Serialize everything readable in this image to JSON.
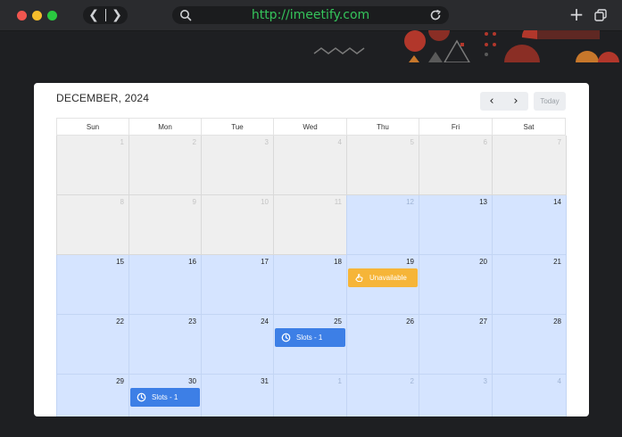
{
  "browser": {
    "url": "http://imeetify.com",
    "colors": {
      "url": "#35c35b",
      "chrome": "#2a2b2e"
    }
  },
  "calendar": {
    "title": "DECEMBER, 2024",
    "prev_label": "‹",
    "next_label": "›",
    "today_label": "Today",
    "weekdays": [
      "Sun",
      "Mon",
      "Tue",
      "Wed",
      "Thu",
      "Fri",
      "Sat"
    ],
    "weeks": [
      [
        {
          "day": "1",
          "state": "past"
        },
        {
          "day": "2",
          "state": "past"
        },
        {
          "day": "3",
          "state": "past"
        },
        {
          "day": "4",
          "state": "past"
        },
        {
          "day": "5",
          "state": "past"
        },
        {
          "day": "6",
          "state": "past"
        },
        {
          "day": "7",
          "state": "past"
        }
      ],
      [
        {
          "day": "8",
          "state": "past"
        },
        {
          "day": "9",
          "state": "past"
        },
        {
          "day": "10",
          "state": "past"
        },
        {
          "day": "11",
          "state": "past"
        },
        {
          "day": "12",
          "state": "avail-dim"
        },
        {
          "day": "13",
          "state": "avail"
        },
        {
          "day": "14",
          "state": "avail"
        }
      ],
      [
        {
          "day": "15",
          "state": "avail"
        },
        {
          "day": "16",
          "state": "avail"
        },
        {
          "day": "17",
          "state": "avail"
        },
        {
          "day": "18",
          "state": "avail"
        },
        {
          "day": "19",
          "state": "avail"
        },
        {
          "day": "20",
          "state": "avail"
        },
        {
          "day": "21",
          "state": "avail"
        }
      ],
      [
        {
          "day": "22",
          "state": "avail"
        },
        {
          "day": "23",
          "state": "avail"
        },
        {
          "day": "24",
          "state": "avail"
        },
        {
          "day": "25",
          "state": "avail"
        },
        {
          "day": "26",
          "state": "avail"
        },
        {
          "day": "27",
          "state": "avail"
        },
        {
          "day": "28",
          "state": "avail"
        }
      ],
      [
        {
          "day": "29",
          "state": "avail"
        },
        {
          "day": "30",
          "state": "avail"
        },
        {
          "day": "31",
          "state": "avail"
        },
        {
          "day": "1",
          "state": "next"
        },
        {
          "day": "2",
          "state": "next"
        },
        {
          "day": "3",
          "state": "next"
        },
        {
          "day": "4",
          "state": "next"
        }
      ]
    ],
    "events": [
      {
        "label": "Unavailable",
        "type": "unavailable",
        "icon": "hand-icon"
      },
      {
        "label": "Slots - 1",
        "type": "slot",
        "icon": "clock-icon"
      },
      {
        "label": "Slots - 1",
        "type": "slot",
        "icon": "clock-icon"
      }
    ],
    "colors": {
      "available": "#d5e4ff",
      "past": "#efefef",
      "slot": "#3d7fe6",
      "unavailable": "#f6b538"
    }
  }
}
